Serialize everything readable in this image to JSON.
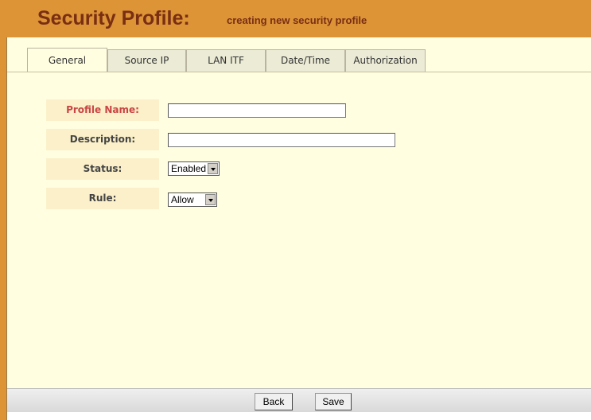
{
  "header": {
    "title": "Security Profile:",
    "subtitle": "creating new security profile"
  },
  "tabs": [
    {
      "label": "General",
      "active": true
    },
    {
      "label": "Source IP",
      "active": false
    },
    {
      "label": "LAN ITF",
      "active": false
    },
    {
      "label": "Date/Time",
      "active": false
    },
    {
      "label": "Authorization",
      "active": false
    }
  ],
  "form": {
    "profile_name": {
      "label": "Profile Name:",
      "value": "",
      "required": true
    },
    "description": {
      "label": "Description:",
      "value": ""
    },
    "status": {
      "label": "Status:",
      "selected": "Enabled"
    },
    "rule": {
      "label": "Rule:",
      "selected": "Allow"
    }
  },
  "footer": {
    "back_label": "Back",
    "save_label": "Save"
  },
  "colors": {
    "header_bg": "#dc9437",
    "title_text": "#7a2e12",
    "panel_bg": "#fffee0",
    "label_bg": "#fbf0c9",
    "required_label": "#c94545"
  }
}
